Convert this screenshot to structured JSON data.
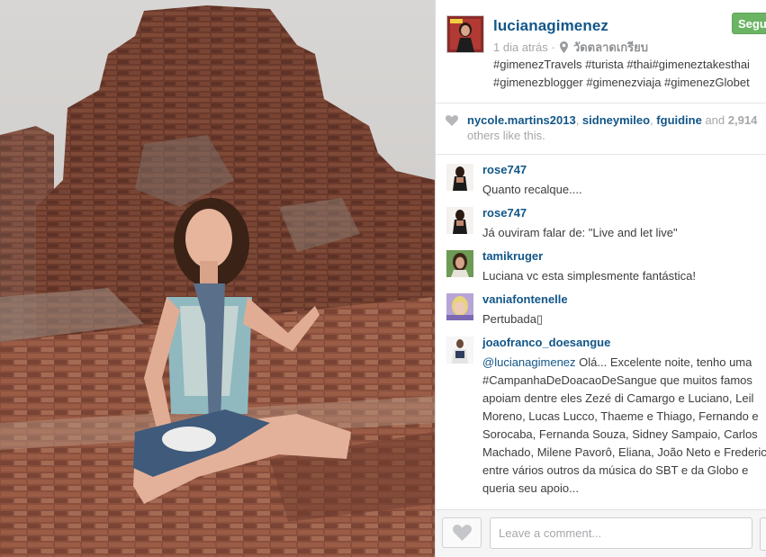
{
  "post": {
    "username": "lucianagimenez",
    "time": "1 dia atrás",
    "separator": "·",
    "location": "วัดตลาดเกรียบ",
    "follow_label": "Segu",
    "caption_line1": "#gimenezTravels #turista #thai#gimeneztakesthai",
    "caption_line2": "#gimenezblogger #gimenezviaja #gimenezGlobet"
  },
  "likes": {
    "user1": "nycole.martins2013",
    "comma1": ", ",
    "user2": "sidneymileo",
    "comma2": ", ",
    "user3": "fguidine",
    "and": " and ",
    "count": "2,914",
    "rest": "others like this."
  },
  "comments": [
    {
      "user": "rose747",
      "text": "Quanto recalque...."
    },
    {
      "user": "rose747",
      "text": "Já ouviram falar de: \"Live and let live\""
    },
    {
      "user": "tamikruger",
      "text": "Luciana vc esta simplesmente fantástica!"
    },
    {
      "user": "vaniafontenelle",
      "text": "Pertubada▯"
    },
    {
      "user": "joaofranco_doesangue",
      "mention": "@lucianagimenez",
      "text": " Olá... Excelente noite, tenho uma #CampanhaDeDoacaoDeSangue que muitos famos apoiam dentre eles Zezé di Camargo e Luciano, Leil Moreno, Lucas Lucco, Thaeme e Thiago, Fernando e Sorocaba, Fernanda Souza, Sidney Sampaio, Carlos Machado, Milene Pavorô, Eliana, João Neto e Frederico entre vários outros da música do SBT e da Globo e queria seu apoio..."
    }
  ],
  "footer": {
    "comment_placeholder": "Leave a comment..."
  },
  "colors": {
    "link": "#125688",
    "muted": "#a5a7aa",
    "follow_bg": "#6bb464"
  },
  "icons": {
    "location": "location-pin-icon",
    "like": "heart-icon"
  }
}
